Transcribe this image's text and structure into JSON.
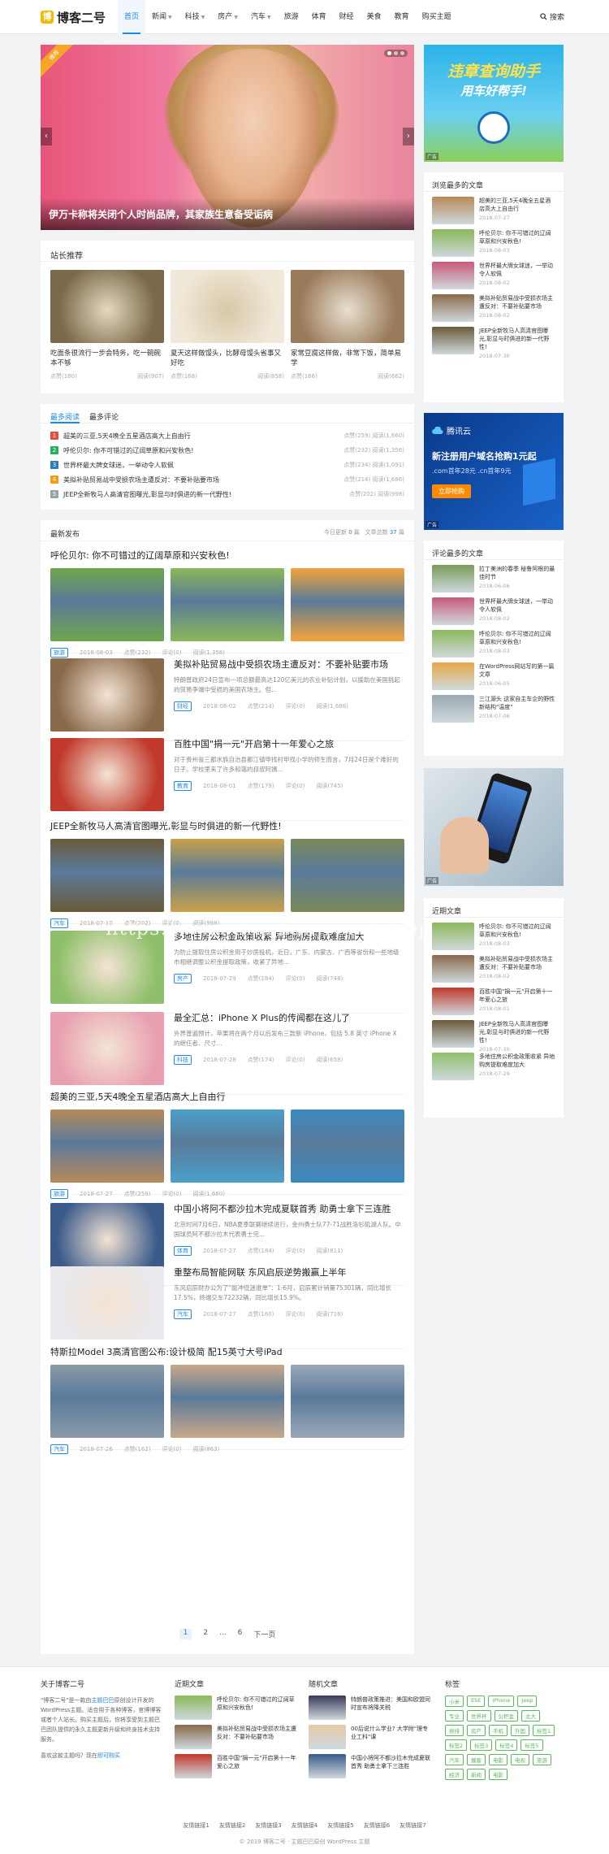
{
  "site": {
    "logo_mark": "博",
    "name": "博客二号",
    "search": "搜索"
  },
  "nav": [
    {
      "label": "首页",
      "active": true,
      "dropdown": false
    },
    {
      "label": "新闻",
      "dropdown": true
    },
    {
      "label": "科技",
      "dropdown": true
    },
    {
      "label": "房产",
      "dropdown": true
    },
    {
      "label": "汽车",
      "dropdown": true
    },
    {
      "label": "旅游",
      "dropdown": false
    },
    {
      "label": "体育",
      "dropdown": false
    },
    {
      "label": "财经",
      "dropdown": false
    },
    {
      "label": "美食",
      "dropdown": false
    },
    {
      "label": "教育",
      "dropdown": false
    },
    {
      "label": "购买主题",
      "dropdown": false
    }
  ],
  "slider": {
    "badge": "推荐",
    "caption": "伊万卡称将关闭个人时尚品牌，其家族生意备受诟病",
    "prev": "‹",
    "next": "›"
  },
  "recommend": {
    "title": "站长推荐",
    "items": [
      {
        "title": "吃面条很流行一步会特务，吃一碗碗本不够",
        "likes": "点赞(180)",
        "views": "阅读(907)"
      },
      {
        "title": "夏天这样做馒头，比酵母馒头省事又好吃",
        "likes": "点赞(168)",
        "views": "阅读(858)"
      },
      {
        "title": "家常豆腐这样做，非常下饭，简单易学",
        "likes": "点赞(166)",
        "views": "阅读(662)"
      }
    ]
  },
  "hot": {
    "tabs": [
      "最多阅读",
      "最多评论"
    ],
    "items": [
      {
        "num": "1",
        "title": "超美的三亚,5天4晚全五星酒店高大上自由行",
        "likes": "点赞(259)",
        "views": "阅读(1,660)",
        "color": "#e74c3c"
      },
      {
        "num": "2",
        "title": "呼伦贝尔: 你不可错过的辽阔草原和兴安秋色!",
        "likes": "点赞(232)",
        "views": "阅读(1,356)",
        "color": "#27ae60"
      },
      {
        "num": "3",
        "title": "世界杯最大牌女球迷，一举动令人软佩",
        "likes": "点赞(234)",
        "views": "阅读(1,091)",
        "color": "#2980b9"
      },
      {
        "num": "4",
        "title": "美拟补贴贸易战中受损农场主遭反对：不要补贴要市场",
        "likes": "点赞(214)",
        "views": "阅读(1,686)",
        "color": "#f39c12"
      },
      {
        "num": "5",
        "title": "JEEP全新牧马人高清官图曝光,彰显与时俱进的新一代野性!",
        "likes": "点赞(202)",
        "views": "阅读(998)",
        "color": "#95a5a6"
      }
    ]
  },
  "latest": {
    "title": "最新发布",
    "today_prefix": "今日更新",
    "today_count": "0",
    "today_suffix": "篇",
    "total_prefix": "文章总数",
    "total_count": "37",
    "total_suffix": "篇",
    "posts": [
      {
        "type": "multi",
        "title": "呼伦贝尔: 你不可错过的辽阔草原和兴安秋色!",
        "tag": "旅游",
        "date": "2018-08-03",
        "likes": "点赞(232)",
        "comments": "评论(0)",
        "views": "阅读(1,356)",
        "colors": [
          "#6fa64b",
          "#8bb85a",
          "#f4a43a"
        ]
      },
      {
        "type": "single",
        "title": "美拟补贴贸易战中受损农场主遭反对：不要补贴要市场",
        "desc": "特朗普政府24日宣布一项总额最高达120亿美元的农业补贴计划，以援助在美国挑起的贸易争端中受损的美国农场主。但...",
        "tag": "财经",
        "date": "2018-08-02",
        "likes": "点赞(214)",
        "comments": "评论(0)",
        "views": "阅读(1,686)",
        "color": "#8a6a4a"
      },
      {
        "type": "single",
        "title": "百胜中国\"捐一元\"开启第十一年爱心之旅",
        "desc": "对于贵州省三都水族自治县都江镇甲找村甲找小学的师生而言，7月24日是个难好的日子。学校里来了许多和蔼的叔叔阿姨...",
        "tag": "教育",
        "date": "2018-08-01",
        "likes": "点赞(179)",
        "comments": "评论(0)",
        "views": "阅读(745)",
        "color": "#c0392b"
      },
      {
        "type": "multi",
        "title": "JEEP全新牧马人高清官图曝光,彰显与时俱进的新一代野性!",
        "tag": "汽车",
        "date": "2018-07-30",
        "likes": "点赞(202)",
        "comments": "评论(0)",
        "views": "阅读(998)",
        "colors": [
          "#6b5a3a",
          "#c9a24a",
          "#7a8a5a"
        ]
      },
      {
        "type": "single",
        "title": "多地住房公积金政策收紧 异地购房提取难度加大",
        "desc": "为防止提取住房公积金用于炒房投机，近日，广东、内蒙古、广西等省份和一些地级市相继调整公积金提取政策，收紧了异地...",
        "tag": "房产",
        "date": "2018-07-29",
        "likes": "点赞(184)",
        "comments": "评论(0)",
        "views": "阅读(748)",
        "color": "#8fbf6a"
      },
      {
        "type": "single",
        "title": "最全汇总：iPhone X Plus的传闻都在这儿了",
        "desc": "外界普遍预计，苹果将在两个月以后发布三款新 iPhone，包括 5.8 英寸 iPhone X 的继任者、尺寸...",
        "tag": "科技",
        "date": "2018-07-28",
        "likes": "点赞(174)",
        "comments": "评论(0)",
        "views": "阅读(658)",
        "color": "#e8a0b0"
      },
      {
        "type": "multi",
        "title": "超美的三亚,5天4晚全五星酒店高大上自由行",
        "tag": "旅游",
        "date": "2018-07-27",
        "likes": "点赞(259)",
        "comments": "评论(0)",
        "views": "阅读(1,660)",
        "colors": [
          "#b88a5a",
          "#4aa0c8",
          "#3a8abf"
        ]
      },
      {
        "type": "single",
        "title": "中国小将阿不都沙拉木完成夏联首秀 助勇士拿下三连胜",
        "desc": "北京时间7月6日，NBA夏季联赛继续进行，金州勇士队77-71战胜洛杉矶湖人队。中国球员阿不都沙拉木代表勇士完...",
        "tag": "体育",
        "date": "2018-07-27",
        "likes": "点赞(184)",
        "comments": "评论(0)",
        "views": "阅读(811)",
        "color": "#3a5a8a"
      },
      {
        "type": "single",
        "title": "重整布局智能网联 东风启辰逆势搬赢上半年",
        "desc": "东风启辰财办公为了\"能冲低迷谁单\"：1-6月，启辰累计销量75301辆，同比增长17.5%，终端交车72232辆，同比增长15.9%。",
        "tag": "汽车",
        "date": "2018-07-27",
        "likes": "点赞(160)",
        "comments": "评论(0)",
        "views": "阅读(716)",
        "color": "#e9e9ee"
      },
      {
        "type": "multi",
        "title": "特斯拉Model 3高清官图公布:设计极简 配15英寸大号iPad",
        "tag": "汽车",
        "date": "2018-07-26",
        "likes": "点赞(162)",
        "comments": "评论(0)",
        "views": "阅读(863)",
        "colors": [
          "#8a9aa8",
          "#c8a88a",
          "#9aa8b8"
        ]
      }
    ]
  },
  "pager": [
    "1",
    "2",
    "...",
    "6",
    "下一页"
  ],
  "side_ad1": {
    "text1": "违章查询助手",
    "text2": "用车好帮手!",
    "label": "广告"
  },
  "side_most_viewed": {
    "title": "浏览最多的文章",
    "items": [
      {
        "title": "超美的三亚,5天4晚全五星酒店高大上自由行",
        "date": "2018-07-27",
        "color": "#b88a5a"
      },
      {
        "title": "呼伦贝尔: 你不可错过的辽阔草原和兴安秋色!",
        "date": "2018-08-03",
        "color": "#8bb85a"
      },
      {
        "title": "世界杯最大牌女球迷，一举动令人软佩",
        "date": "2018-08-02",
        "color": "#c85a7a"
      },
      {
        "title": "美拟补贴贸易战中受损农场主遭反对：不要补贴要市场",
        "date": "2018-08-02",
        "color": "#8a6a4a"
      },
      {
        "title": "JEEP全新牧马人高清官图曝光,彰显与时俱进的新一代野性!",
        "date": "2018-07-30",
        "color": "#6b5a3a"
      }
    ]
  },
  "side_ad2": {
    "brand": "腾讯云",
    "line1": "新注册用户域名抢购1元起",
    "line2": ".com首年28元 .cn首年9元",
    "button": "立即抢购",
    "label": "广告"
  },
  "side_most_commented": {
    "title": "评论最多的文章",
    "items": [
      {
        "title": "拉丁美洲的春季 秘鲁阿根的最佳时节",
        "date": "2018-06-06",
        "color": "#7a9a5a"
      },
      {
        "title": "世界杯最大牌女球迷，一举动令人软佩",
        "date": "2018-08-02",
        "color": "#c85a7a"
      },
      {
        "title": "呼伦贝尔: 你不可错过的辽阔草原和兴安秋色!",
        "date": "2018-08-03",
        "color": "#8bb85a"
      },
      {
        "title": "在WordPress网站写的第一篇文章",
        "date": "2018-06-05",
        "color": "#e8a84a"
      },
      {
        "title": "三江源头 这家自主车企的野性新结构\"温度\"",
        "date": "2018-07-06",
        "color": "#9aa8b0"
      }
    ]
  },
  "side_ad3": {
    "label": "广告"
  },
  "side_recent": {
    "title": "近期文章",
    "items": [
      {
        "title": "呼伦贝尔: 你不可错过的辽阔草原和兴安秋色!",
        "date": "2018-08-03",
        "color": "#8bb85a"
      },
      {
        "title": "美拟补贴贸易战中受损农场主遭反对：不要补贴要市场",
        "date": "2018-08-02",
        "color": "#8a6a4a"
      },
      {
        "title": "百胜中国\"捐一元\"开启第十一年爱心之旅",
        "date": "2018-08-01",
        "color": "#c0392b"
      },
      {
        "title": "JEEP全新牧马人高清官图曝光,彰显与时俱进的新一代野性!",
        "date": "2018-07-30",
        "color": "#6b5a3a"
      },
      {
        "title": "多地住房公积金政策收紧 异地购房提取难度加大",
        "date": "2018-07-29",
        "color": "#8fbf6a"
      }
    ]
  },
  "watermark": "https://www.huzhan.com/ishop28866",
  "footer": {
    "about_title": "关于博客二号",
    "about_text_a": "\"博客二号\"是一款由",
    "about_link": "主题巴巴",
    "about_text_b": "原创设计开发的WordPress主题。适合用于各种博客，官博博客或者个人站长。购买主题后，你将享受到主题巴巴团队提供的永久主题更新升级和终身技术支持服务。",
    "about_more_a": "喜欢这款主题吗？现在",
    "about_more_link": "即可购买",
    "recent_title": "近期文章",
    "recent": [
      {
        "title": "呼伦贝尔: 你不可错过的辽阔草原和兴安秋色!",
        "color": "#8bb85a"
      },
      {
        "title": "美拟补贴贸易战中受损农场主遭反对：不要补贴要市场",
        "color": "#8a6a4a"
      },
      {
        "title": "百胜中国\"捐一元\"开启第十一年爱心之旅",
        "color": "#c0392b"
      }
    ],
    "random_title": "随机文章",
    "random": [
      {
        "title": "特朗普政策推进：美国和欧盟同时宣布将降关税",
        "color": "#3a3a5a"
      },
      {
        "title": "00后说什么学业? 大学附\"理专业工科\"课",
        "color": "#e8c8a8"
      },
      {
        "title": "中国小将阿不都沙拉木完成夏联首秀 助勇士拿下三连胜",
        "color": "#3a5a8a"
      }
    ],
    "tags_title": "标签",
    "tags": [
      "小米",
      "ESE",
      "iPhone",
      "Jeep",
      "专业",
      "世界杯",
      "公积金",
      "北大",
      "拼排",
      "房产",
      "手机",
      "外国",
      "标签1",
      "标签2",
      "标签3",
      "标签4",
      "标签5",
      "汽车",
      "播客",
      "电影",
      "电视",
      "旅游",
      "经济",
      "新闻",
      "电影"
    ],
    "links": [
      "友情链接1",
      "友情链接2",
      "友情链接3",
      "友情链接4",
      "友情链接5",
      "友情链接6",
      "友情链接7"
    ],
    "copyright": "© 2019 博客二号 · 主题巴巴原创 WordPress 主题"
  },
  "colors": {
    "accent": "#1e88e5",
    "tag_green": "#5cb85c"
  }
}
